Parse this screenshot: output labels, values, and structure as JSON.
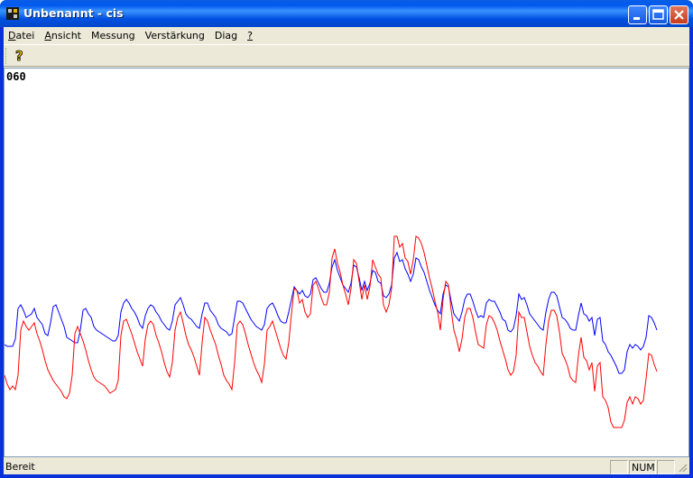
{
  "window": {
    "title": "Unbenannt - cis"
  },
  "menu": [
    {
      "label": "Datei",
      "underline": "D"
    },
    {
      "label": "Ansicht",
      "underline": "A"
    },
    {
      "label": "Messung",
      "underline": ""
    },
    {
      "label": "Verstärkung",
      "underline": ""
    },
    {
      "label": "Diag",
      "underline": ""
    },
    {
      "label": "?",
      "underline": "?"
    }
  ],
  "toolbar": {
    "help_icon": "help-question-icon"
  },
  "display": {
    "counter": "060"
  },
  "status": {
    "text": "Bereit",
    "num": "NUM"
  },
  "colors": {
    "blue_series": "#0000ff",
    "red_series": "#ff0000",
    "titlebar": "#0058ee"
  },
  "chart_data": {
    "type": "line",
    "title": "",
    "x": [
      0,
      3,
      6,
      9,
      12,
      15,
      18,
      21,
      24,
      27,
      30,
      33,
      36,
      39,
      42,
      45,
      48,
      51,
      54,
      57,
      60,
      63,
      66,
      69,
      72,
      75,
      78,
      81,
      84,
      87,
      90,
      93,
      96,
      99,
      102,
      105,
      108,
      111,
      114,
      117,
      120,
      123,
      126,
      129,
      132,
      135,
      138,
      141,
      144,
      147,
      150,
      153,
      156,
      159,
      162,
      165,
      168,
      171,
      174,
      177,
      180,
      183,
      186,
      189,
      192,
      195,
      198,
      201,
      204,
      207,
      210,
      213,
      216,
      219,
      222,
      225,
      228,
      231,
      234,
      237,
      240,
      243,
      246,
      249,
      252,
      255,
      258,
      261,
      264,
      267,
      270,
      273,
      276,
      279,
      282,
      285,
      288,
      291,
      294,
      297,
      300,
      303,
      306,
      309,
      312,
      315,
      318,
      321,
      324,
      327,
      330,
      333,
      336,
      339,
      342,
      345,
      348,
      351,
      354,
      357,
      360,
      363,
      366,
      369,
      372,
      375,
      378,
      381,
      384,
      387,
      390,
      393,
      396,
      399,
      402,
      405,
      408,
      411,
      414,
      417,
      420,
      423,
      426,
      429,
      432,
      435,
      438,
      441,
      444,
      447,
      450,
      453,
      456,
      459,
      462,
      465,
      468,
      471,
      474,
      477,
      480,
      483,
      486,
      489,
      492,
      495,
      498,
      501,
      504,
      507,
      510,
      513,
      516,
      519,
      522,
      525,
      528,
      531,
      534,
      537,
      540,
      543,
      546,
      549,
      552,
      555,
      558,
      561,
      564,
      567,
      570,
      573,
      576,
      579,
      582,
      585,
      588,
      591,
      594,
      597,
      600,
      603,
      606,
      609,
      612,
      615,
      618,
      621,
      624,
      627,
      630,
      633,
      636,
      639,
      642,
      645,
      648,
      651,
      654,
      657,
      660,
      663,
      666,
      669,
      672,
      675,
      678,
      681,
      684,
      687,
      690,
      693,
      696,
      699,
      702,
      705,
      708,
      711,
      714,
      717,
      720,
      723,
      726,
      729,
      732,
      735,
      738,
      741,
      744,
      747,
      750,
      753,
      756
    ],
    "series": [
      {
        "color": "#0000ff",
        "values": [
          306,
          308,
          308,
          308,
          300,
          266,
          262,
          268,
          276,
          274,
          272,
          266,
          276,
          280,
          284,
          294,
          296,
          282,
          264,
          262,
          270,
          278,
          286,
          298,
          300,
          302,
          304,
          304,
          290,
          268,
          266,
          272,
          276,
          286,
          290,
          292,
          294,
          296,
          298,
          300,
          302,
          302,
          296,
          270,
          260,
          256,
          260,
          266,
          270,
          276,
          284,
          288,
          274,
          266,
          262,
          264,
          270,
          274,
          280,
          284,
          288,
          290,
          280,
          262,
          258,
          254,
          262,
          272,
          276,
          278,
          282,
          286,
          288,
          272,
          260,
          260,
          268,
          272,
          276,
          284,
          288,
          290,
          292,
          296,
          294,
          276,
          258,
          258,
          260,
          266,
          272,
          278,
          282,
          286,
          288,
          290,
          284,
          266,
          262,
          260,
          266,
          274,
          280,
          282,
          282,
          270,
          256,
          242,
          246,
          250,
          246,
          252,
          254,
          250,
          234,
          232,
          238,
          244,
          248,
          248,
          238,
          220,
          212,
          224,
          232,
          240,
          244,
          248,
          238,
          218,
          220,
          232,
          246,
          236,
          246,
          238,
          224,
          226,
          236,
          238,
          252,
          254,
          250,
          240,
          210,
          204,
          214,
          212,
          222,
          228,
          236,
          228,
          210,
          212,
          220,
          226,
          236,
          246,
          254,
          262,
          268,
          272,
          250,
          240,
          242,
          258,
          272,
          276,
          280,
          270,
          256,
          250,
          250,
          258,
          268,
          276,
          274,
          276,
          260,
          256,
          258,
          258,
          264,
          270,
          278,
          280,
          290,
          292,
          288,
          274,
          250,
          256,
          254,
          262,
          272,
          276,
          280,
          284,
          288,
          290,
          270,
          256,
          248,
          248,
          252,
          264,
          276,
          278,
          282,
          288,
          290,
          290,
          274,
          260,
          272,
          274,
          280,
          276,
          296,
          278,
          276,
          302,
          306,
          314,
          318,
          324,
          330,
          338,
          338,
          334,
          314,
          306,
          310,
          306,
          308,
          312,
          308,
          298,
          274,
          276,
          282,
          290
        ],
        "name": ""
      },
      {
        "color": "#ff0000",
        "values": [
          340,
          350,
          356,
          352,
          356,
          340,
          290,
          280,
          286,
          290,
          286,
          282,
          294,
          302,
          312,
          324,
          334,
          340,
          346,
          350,
          354,
          358,
          364,
          366,
          360,
          340,
          294,
          286,
          294,
          302,
          312,
          324,
          334,
          342,
          346,
          348,
          350,
          352,
          356,
          360,
          358,
          356,
          346,
          296,
          280,
          278,
          286,
          294,
          304,
          314,
          322,
          330,
          300,
          284,
          280,
          284,
          296,
          304,
          314,
          326,
          336,
          342,
          326,
          290,
          276,
          270,
          282,
          296,
          306,
          312,
          320,
          330,
          340,
          304,
          276,
          280,
          290,
          298,
          306,
          318,
          328,
          340,
          346,
          350,
          356,
          326,
          284,
          280,
          284,
          294,
          306,
          316,
          326,
          334,
          340,
          348,
          328,
          290,
          286,
          280,
          290,
          300,
          310,
          318,
          322,
          304,
          272,
          244,
          246,
          260,
          256,
          270,
          276,
          272,
          240,
          236,
          244,
          254,
          262,
          262,
          248,
          210,
          200,
          216,
          226,
          240,
          250,
          262,
          244,
          212,
          216,
          236,
          256,
          240,
          256,
          242,
          212,
          220,
          228,
          232,
          262,
          270,
          262,
          244,
          186,
          186,
          198,
          194,
          210,
          214,
          228,
          212,
          186,
          188,
          194,
          204,
          218,
          232,
          244,
          258,
          270,
          290,
          256,
          236,
          240,
          268,
          290,
          300,
          314,
          300,
          276,
          266,
          266,
          276,
          292,
          306,
          308,
          310,
          284,
          274,
          276,
          282,
          290,
          302,
          312,
          322,
          334,
          340,
          336,
          318,
          270,
          276,
          276,
          292,
          308,
          318,
          326,
          330,
          336,
          340,
          306,
          280,
          268,
          268,
          274,
          292,
          316,
          322,
          330,
          342,
          346,
          348,
          318,
          298,
          320,
          324,
          334,
          326,
          358,
          330,
          326,
          364,
          368,
          376,
          392,
          398,
          398,
          398,
          398,
          390,
          370,
          364,
          372,
          364,
          366,
          372,
          368,
          344,
          316,
          318,
          328,
          336
        ],
        "name": ""
      }
    ],
    "ylim": [
      0,
      432
    ],
    "xlabel": "",
    "ylabel": "",
    "grid": false
  }
}
